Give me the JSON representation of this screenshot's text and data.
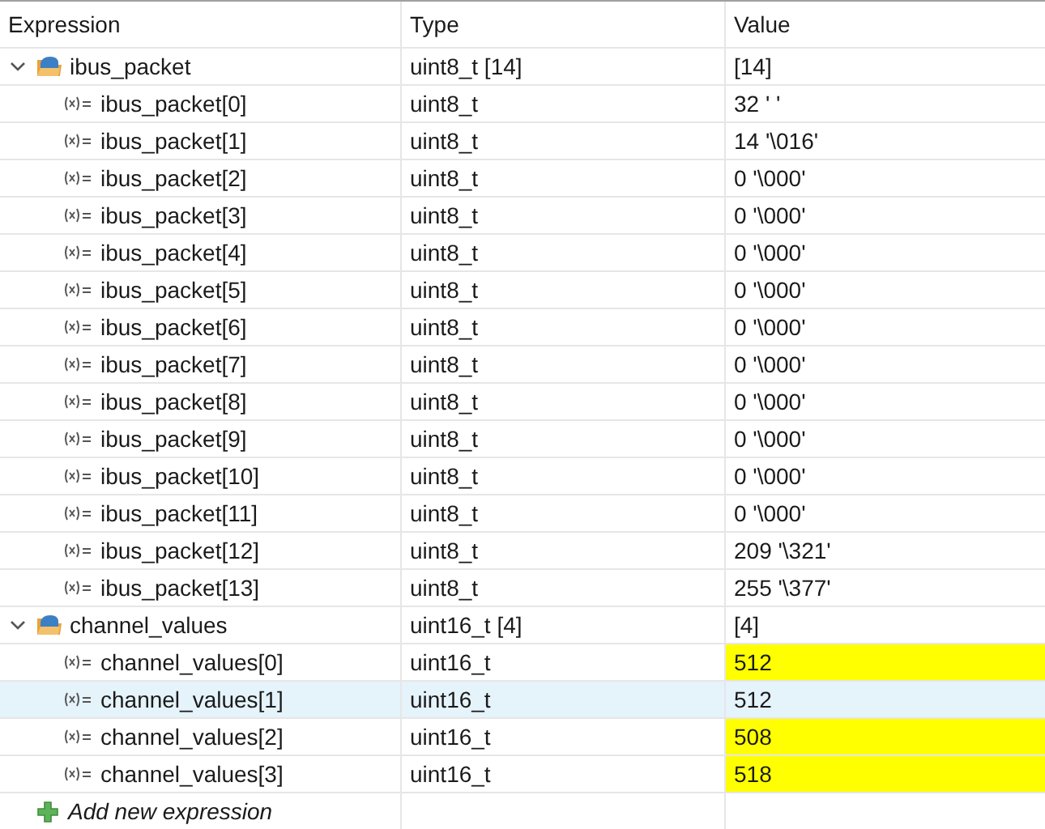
{
  "columns": [
    "Expression",
    "Type",
    "Value"
  ],
  "expressions": [
    {
      "name": "ibus_packet",
      "type": "uint8_t [14]",
      "value": "[14]",
      "expanded": true,
      "selected": false,
      "changed": false,
      "children": [
        {
          "name": "ibus_packet[0]",
          "type": "uint8_t",
          "value": "32 ' '",
          "selected": false,
          "changed": false
        },
        {
          "name": "ibus_packet[1]",
          "type": "uint8_t",
          "value": "14 '\\016'",
          "selected": false,
          "changed": false
        },
        {
          "name": "ibus_packet[2]",
          "type": "uint8_t",
          "value": "0 '\\000'",
          "selected": false,
          "changed": false
        },
        {
          "name": "ibus_packet[3]",
          "type": "uint8_t",
          "value": "0 '\\000'",
          "selected": false,
          "changed": false
        },
        {
          "name": "ibus_packet[4]",
          "type": "uint8_t",
          "value": "0 '\\000'",
          "selected": false,
          "changed": false
        },
        {
          "name": "ibus_packet[5]",
          "type": "uint8_t",
          "value": "0 '\\000'",
          "selected": false,
          "changed": false
        },
        {
          "name": "ibus_packet[6]",
          "type": "uint8_t",
          "value": "0 '\\000'",
          "selected": false,
          "changed": false
        },
        {
          "name": "ibus_packet[7]",
          "type": "uint8_t",
          "value": "0 '\\000'",
          "selected": false,
          "changed": false
        },
        {
          "name": "ibus_packet[8]",
          "type": "uint8_t",
          "value": "0 '\\000'",
          "selected": false,
          "changed": false
        },
        {
          "name": "ibus_packet[9]",
          "type": "uint8_t",
          "value": "0 '\\000'",
          "selected": false,
          "changed": false
        },
        {
          "name": "ibus_packet[10]",
          "type": "uint8_t",
          "value": "0 '\\000'",
          "selected": false,
          "changed": false
        },
        {
          "name": "ibus_packet[11]",
          "type": "uint8_t",
          "value": "0 '\\000'",
          "selected": false,
          "changed": false
        },
        {
          "name": "ibus_packet[12]",
          "type": "uint8_t",
          "value": "209 '\\321'",
          "selected": false,
          "changed": false
        },
        {
          "name": "ibus_packet[13]",
          "type": "uint8_t",
          "value": "255 '\\377'",
          "selected": false,
          "changed": false
        }
      ]
    },
    {
      "name": "channel_values",
      "type": "uint16_t [4]",
      "value": "[4]",
      "expanded": true,
      "selected": false,
      "changed": false,
      "children": [
        {
          "name": "channel_values[0]",
          "type": "uint16_t",
          "value": "512",
          "selected": false,
          "changed": true
        },
        {
          "name": "channel_values[1]",
          "type": "uint16_t",
          "value": "512",
          "selected": true,
          "changed": false
        },
        {
          "name": "channel_values[2]",
          "type": "uint16_t",
          "value": "508",
          "selected": false,
          "changed": true
        },
        {
          "name": "channel_values[3]",
          "type": "uint16_t",
          "value": "518",
          "selected": false,
          "changed": true
        }
      ]
    }
  ],
  "add_row": {
    "label": "Add new expression"
  }
}
